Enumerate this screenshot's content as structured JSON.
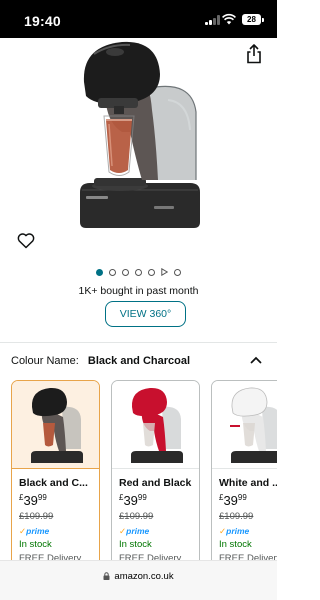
{
  "status_bar": {
    "time": "19:40",
    "battery": "28"
  },
  "product": {
    "bought_text": "1K+ bought in past month",
    "view360_label": "VIEW 360°",
    "carousel": {
      "total_images": 6,
      "active_index": 0,
      "has_video": true
    }
  },
  "colour": {
    "label": "Colour Name:",
    "value": "Black and Charcoal"
  },
  "swatches": [
    {
      "name": "Black and C...",
      "currency": "£",
      "price_whole": "39",
      "price_cents": "99",
      "was_price": "£109.99",
      "prime": "prime",
      "stock": "In stock",
      "delivery": "FREE Delivery",
      "accent": "#2b2b2b"
    },
    {
      "name": "Red and Black",
      "currency": "£",
      "price_whole": "39",
      "price_cents": "99",
      "was_price": "£109.99",
      "prime": "prime",
      "stock": "In stock",
      "delivery": "FREE Delivery",
      "accent": "#c8102e"
    },
    {
      "name": "White and ...",
      "currency": "£",
      "price_whole": "39",
      "price_cents": "99",
      "was_price": "£109.99",
      "prime": "prime",
      "stock": "In stock",
      "delivery": "FREE Delivery",
      "accent": "#f2f2f2"
    }
  ],
  "url_bar": {
    "domain": "amazon.co.uk"
  },
  "colors": {
    "link_teal": "#007185",
    "selected_border": "#e8a44a",
    "in_stock_green": "#007600",
    "prime_blue": "#1a98ff"
  }
}
